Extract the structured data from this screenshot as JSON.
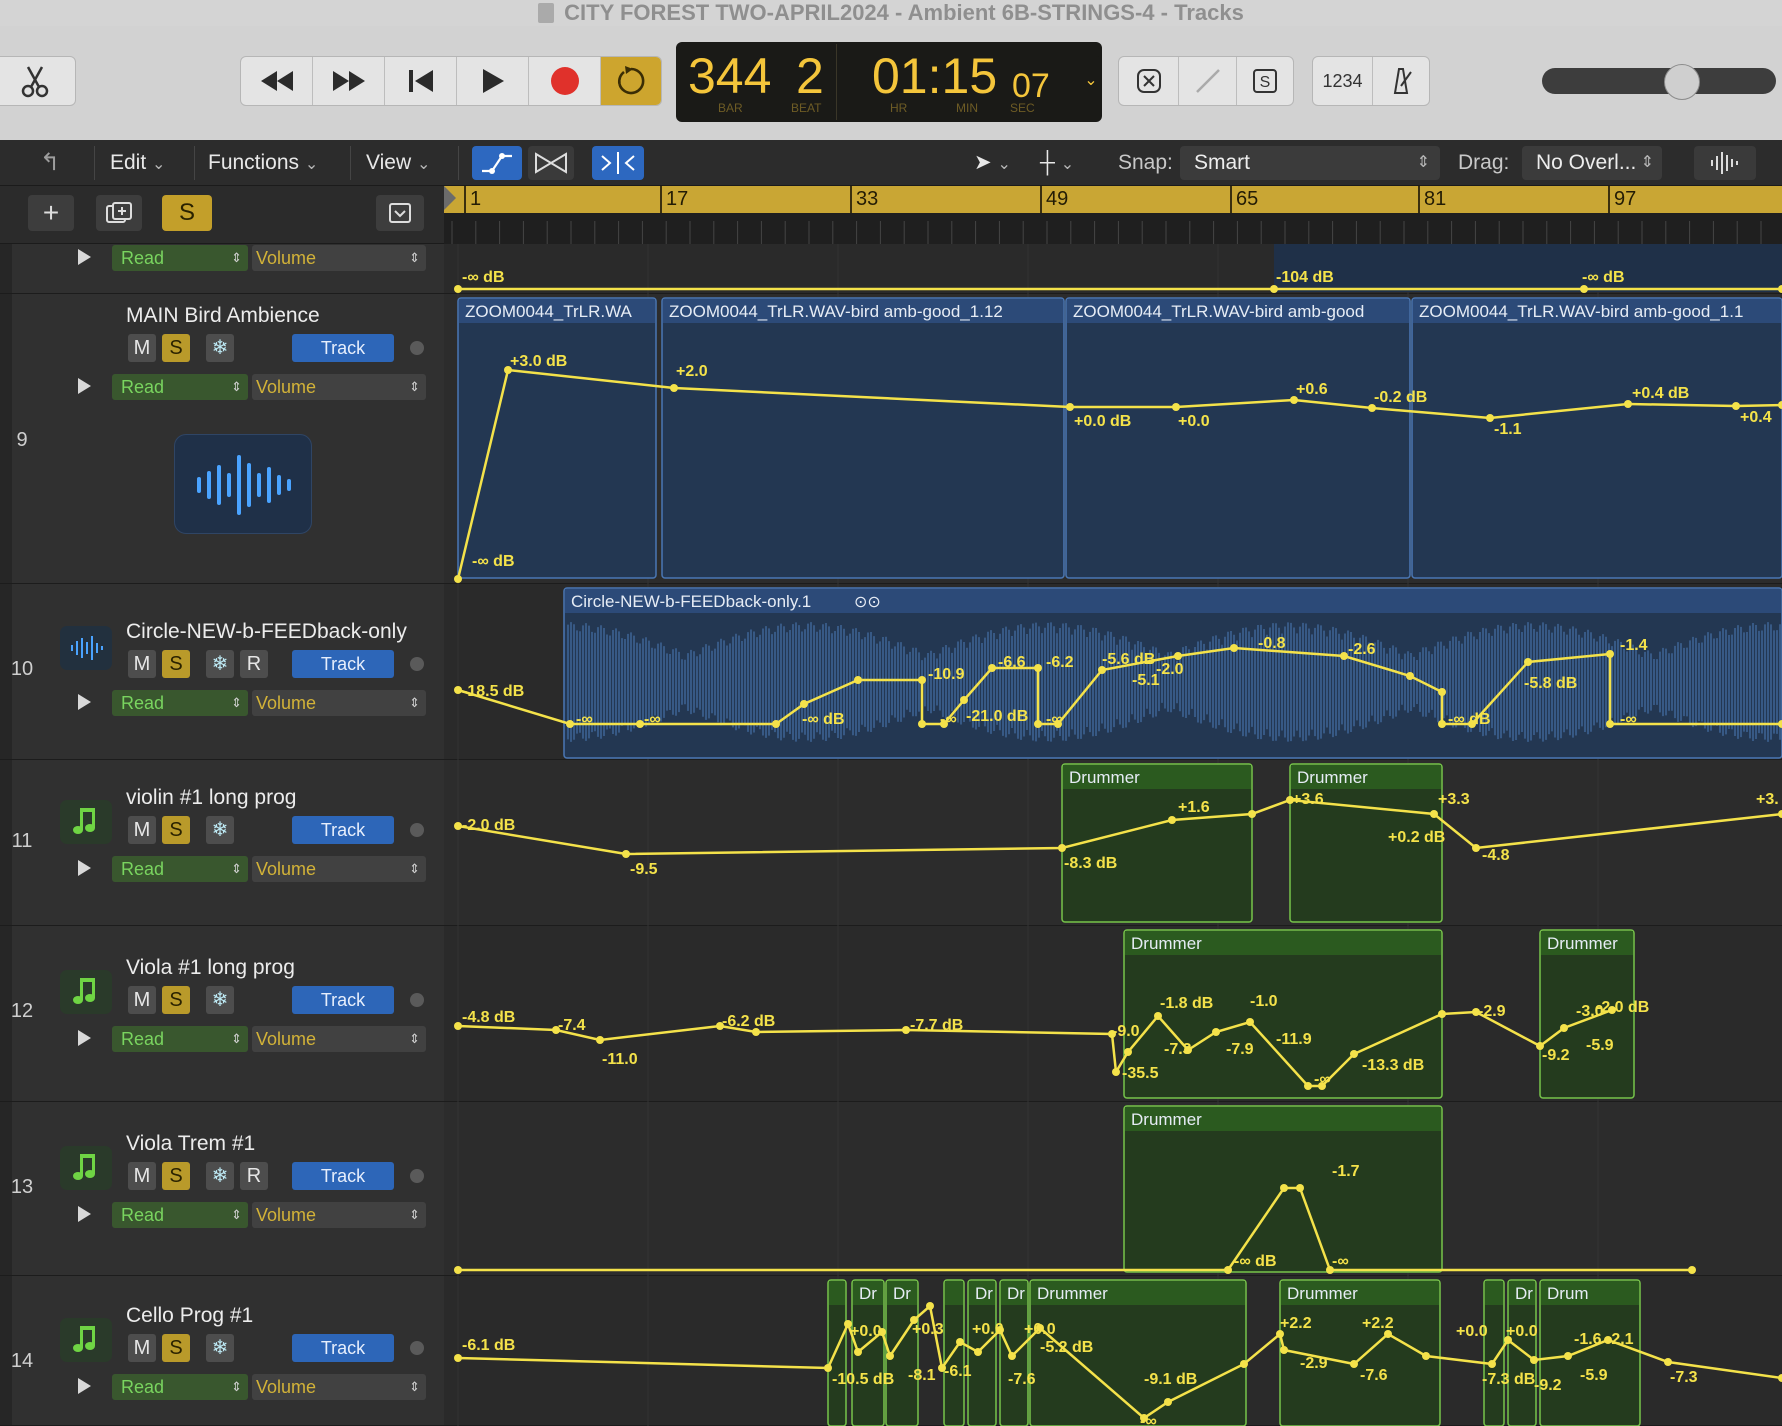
{
  "window": {
    "title": "CITY FOREST TWO-APRIL2024 - Ambient 6B-STRINGS-4 - Tracks"
  },
  "colors": {
    "accent_yellow": "#f4e24a",
    "lcd_text": "#f4c53b",
    "audio_region": "#2c4a78",
    "midi_region": "#2b4f1f",
    "record_red": "#e0312b",
    "cycle_gold": "#cda52e"
  },
  "lcd": {
    "bar": "344",
    "beat": "2",
    "time_main": "01:15",
    "time_frames": "07",
    "labels": {
      "bar": "BAR",
      "beat": "BEAT",
      "hr": "HR",
      "min": "MIN",
      "sec": "SEC"
    }
  },
  "control_bar": {
    "buttons": [
      "scissors-icon",
      "rewind-icon",
      "fast-forward-icon",
      "go-to-start-icon",
      "play-icon",
      "record-icon",
      "cycle-icon"
    ],
    "right_buttons": {
      "count_in": "1234"
    }
  },
  "master_volume": {
    "level": 0.55
  },
  "tracks_toolbar": {
    "edit": "Edit",
    "functions": "Functions",
    "view": "View",
    "snap_label": "Snap:",
    "snap_value": "Smart",
    "drag_label": "Drag:",
    "drag_value": "No Overl..."
  },
  "header_row": {
    "solo_label": "S"
  },
  "ruler": {
    "bars": [
      "1",
      "17",
      "33",
      "49",
      "65",
      "81",
      "97"
    ]
  },
  "tracks": [
    {
      "number": "",
      "name": "",
      "automation_mode": "Read",
      "parameter": "Volume"
    },
    {
      "number": "9",
      "name": "MAIN Bird Ambience",
      "mute": "M",
      "solo": "S",
      "track_label": "Track",
      "automation_mode": "Read",
      "parameter": "Volume"
    },
    {
      "number": "10",
      "name": "Circle-NEW-b-FEEDback-only",
      "mute": "M",
      "solo": "S",
      "record": "R",
      "track_label": "Track",
      "automation_mode": "Read",
      "parameter": "Volume"
    },
    {
      "number": "11",
      "name": "violin #1 long prog",
      "mute": "M",
      "solo": "S",
      "track_label": "Track",
      "automation_mode": "Read",
      "parameter": "Volume"
    },
    {
      "number": "12",
      "name": "Viola #1 long prog",
      "mute": "M",
      "solo": "S",
      "track_label": "Track",
      "automation_mode": "Read",
      "parameter": "Volume"
    },
    {
      "number": "13",
      "name": "Viola Trem #1",
      "mute": "M",
      "solo": "S",
      "record": "R",
      "track_label": "Track",
      "automation_mode": "Read",
      "parameter": "Volume"
    },
    {
      "number": "14",
      "name": "Cello Prog #1",
      "mute": "M",
      "solo": "S",
      "track_label": "Track",
      "automation_mode": "Read",
      "parameter": "Volume"
    }
  ],
  "regions": {
    "track9": [
      "ZOOM0044_TrLR.WA",
      "ZOOM0044_TrLR.WAV-bird amb-good_1.12",
      "ZOOM0044_TrLR.WAV-bird amb-good",
      "ZOOM0044_TrLR.WAV-bird amb-good_1.1"
    ],
    "track10": [
      "Circle-NEW-b-FEEDback-only.1"
    ],
    "track11": [
      "Drummer",
      "Drummer"
    ],
    "track12": [
      "Drummer",
      "Drummer"
    ],
    "track13": [
      "Drummer"
    ],
    "track14": [
      "",
      "Dr",
      "Dr",
      "",
      "Dr",
      "Dr",
      "Drummer",
      "Drummer",
      "",
      "Dr",
      "Drum"
    ]
  },
  "automation_labels": {
    "track8": [
      "-∞ dB",
      "-104 dB",
      "-∞ dB"
    ],
    "track9": [
      "+3.0 dB",
      "+2.0",
      "+0.0 dB",
      "+0.0",
      "+0.6",
      "-0.2 dB",
      "-1.1",
      "+0.4 dB",
      "+0.4",
      "-∞ dB"
    ],
    "track10": [
      "-18.5 dB",
      "-∞",
      "-∞",
      "-∞ dB",
      "-10.9",
      "-∞",
      "-21.0 dB",
      "-∞",
      "-6.6",
      "-6.2",
      "-5.6 dB",
      "-5.1",
      "-2.0",
      "-0.8",
      "-2.6",
      "-∞ dB",
      "-5.8 dB",
      "-1.4",
      "-∞"
    ],
    "track11": [
      "-2.0 dB",
      "-9.5",
      "-8.3 dB",
      "+1.6",
      "+3.6",
      "+0.2 dB",
      "+3.3",
      "-4.8",
      "+3."
    ],
    "track12": [
      "-4.8 dB",
      "-7.4",
      "-11.0",
      "-6.2 dB",
      "-7.7 dB",
      "-9.0",
      "-35.5",
      "-1.8 dB",
      "-7.3",
      "-7.9",
      "-1.0",
      "-11.9",
      "-∞",
      "-13.3 dB",
      "-2.9",
      "-3.0",
      "-2.0 dB",
      "-9.2",
      "-5.9"
    ],
    "track13": [
      "-∞ dB",
      "-1.7",
      "-∞"
    ],
    "track14": [
      "-6.1 dB",
      "-10.5 dB",
      "+0.0",
      "+0.3",
      "-8.1",
      "-6.1",
      "+0.0",
      "+0.0",
      "-7.6",
      "-5.2 dB",
      "-∞",
      "-9.1 dB",
      "+2.2",
      "+2.2",
      "-2.9",
      "-7.6",
      "+0.0",
      "+0.0",
      "-7.3 dB",
      "-9.2",
      "-1.6",
      "-2.1",
      "-5.9",
      "-7.3"
    ]
  }
}
